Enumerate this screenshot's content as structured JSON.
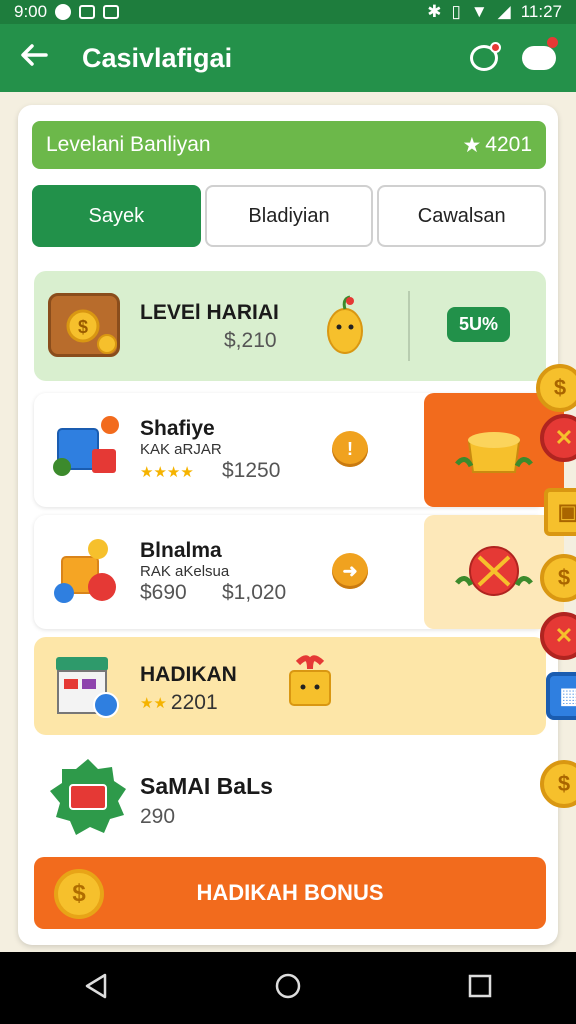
{
  "status_bar": {
    "time_left": "9:00",
    "time_right": "11:27"
  },
  "app_bar": {
    "title": "Casivlafigai"
  },
  "level_bar": {
    "label": "Levelani Banliyan",
    "score": "4201"
  },
  "tabs": [
    {
      "label": "Sayek",
      "active": true
    },
    {
      "label": "Bladiyian",
      "active": false
    },
    {
      "label": "Cawalsan",
      "active": false
    }
  ],
  "rows": [
    {
      "title": "LEVEl HARIAI",
      "price": "$,210",
      "badge": "5U%"
    },
    {
      "title": "Shafiye",
      "subtitle": "KAK aRJAR",
      "price": "$1250"
    },
    {
      "title": "Blnalma",
      "subtitle": "RAK aKelsua",
      "old_price": "$690",
      "price": "$1,020"
    },
    {
      "title": "HADIKAN",
      "score": "2201"
    },
    {
      "title": "SaMAI BaLs",
      "price": "290"
    }
  ],
  "bonus_button": {
    "label": "HADIKAH BONUS"
  },
  "colors": {
    "primary_green": "#24914a",
    "accent_orange": "#f26b1d",
    "gold": "#f6c02c"
  }
}
